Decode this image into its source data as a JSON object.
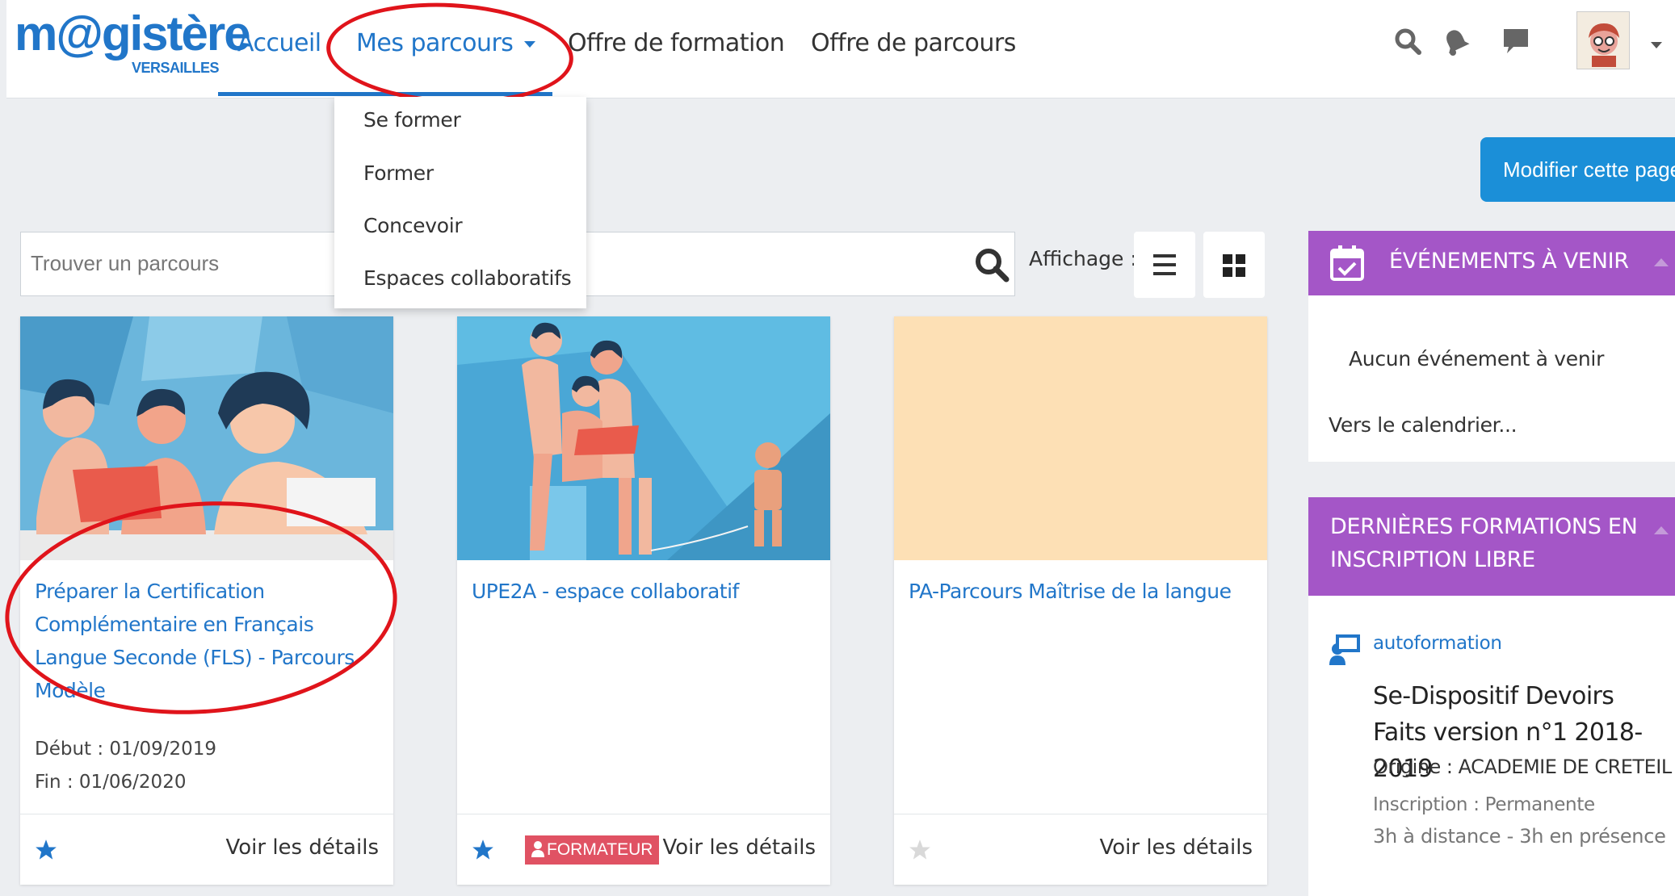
{
  "header": {
    "logo_main": "m@gistère",
    "logo_sub": "VERSAILLES",
    "nav": {
      "accueil": "Accueil",
      "mes_parcours": "Mes parcours",
      "offre_formation": "Offre de formation",
      "offre_parcours": "Offre de parcours"
    }
  },
  "dropdown": {
    "items": [
      "Se former",
      "Former",
      "Concevoir",
      "Espaces collaboratifs"
    ]
  },
  "modify_button": "Modifier cette page",
  "search": {
    "placeholder": "Trouver un parcours"
  },
  "affichage_label": "Affichage :",
  "cards": [
    {
      "title": "Préparer la Certification Complémentaire en Français Langue Seconde (FLS) - Parcours Modèle",
      "start": "Début : 01/09/2019",
      "end": "Fin : 01/06/2020",
      "details": "Voir les détails",
      "starred": true
    },
    {
      "title": "UPE2A - espace collaboratif",
      "badge": "FORMATEUR",
      "details": "Voir les détails",
      "starred": true
    },
    {
      "title": "PA-Parcours Maîtrise de la langue",
      "details": "Voir les détails",
      "starred": false
    }
  ],
  "events_panel": {
    "title": "ÉVÉNEMENTS À VENIR",
    "empty": "Aucun événement à venir",
    "link": "Vers le calendrier..."
  },
  "formations_panel": {
    "title": "DERNIÈRES FORMATIONS EN INSCRIPTION LIBRE",
    "type": "autoformation",
    "course_title": "Se-Dispositif Devoirs Faits version n°1 2018-2019",
    "origin": "Origine : ACADEMIE DE CRETEIL",
    "inscription": "Inscription : Permanente",
    "duration": "3h à distance - 3h en présence"
  },
  "colors": {
    "brand_blue": "#2176c9",
    "button_blue": "#1b8fd8",
    "panel_purple": "#a456c7",
    "badge_red": "#e05263",
    "annotation_red": "#e0141b"
  },
  "icons": [
    "search-icon",
    "bell-icon",
    "chat-icon",
    "list-view-icon",
    "grid-view-icon",
    "calendar-icon",
    "star-icon",
    "user-icon",
    "presentation-icon"
  ]
}
